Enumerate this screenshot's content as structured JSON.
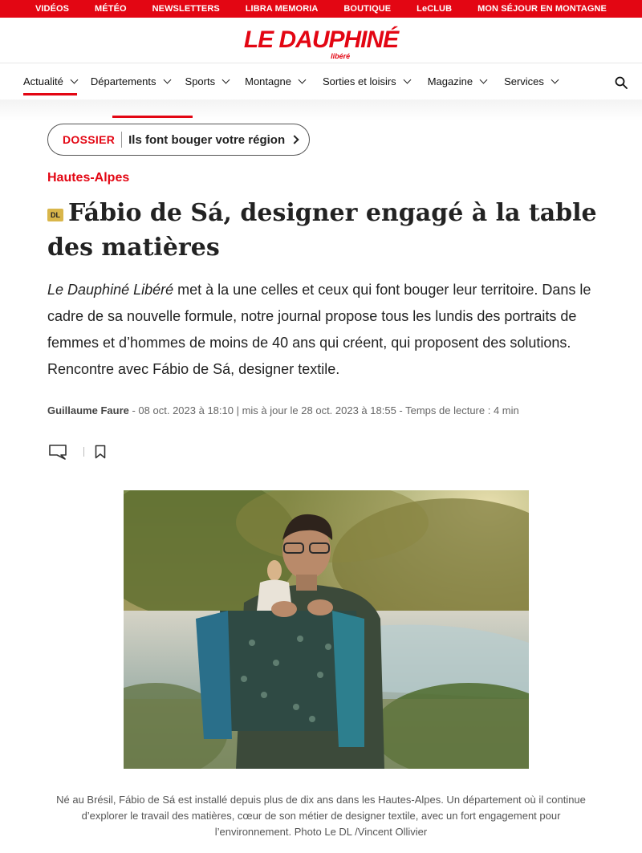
{
  "topbar": {
    "links": [
      "VIDÉOS",
      "MÉTÉO",
      "NEWSLETTERS",
      "LIBRA MEMORIA",
      "BOUTIQUE",
      "LeCLUB",
      "MON SÉJOUR EN MONTAGNE"
    ]
  },
  "logo": {
    "main": "LE DAUPHINÉ",
    "sub": "libéré"
  },
  "nav": {
    "items": [
      "Actualité",
      "Départements",
      "Sports",
      "Montagne",
      "Sorties et loisirs",
      "Magazine",
      "Services"
    ],
    "active_index": 0
  },
  "dossier": {
    "tag": "DOSSIER",
    "title": "Ils font bouger votre région"
  },
  "article": {
    "section": "Hautes-Alpes",
    "badge": "DL",
    "title": "Fábio de Sá, designer engagé à la table des matières",
    "lead_em": "Le Dauphiné Libéré",
    "lead_rest": " met à la une celles et ceux qui font bouger leur territoire. Dans le cadre de sa nouvelle formule, notre journal propose tous les lundis des portraits de femmes et d’hommes de moins de 40 ans qui créent, qui proposent des solutions. Rencontre avec Fábio de Sá, designer textile.",
    "author": "Guillaume Faure",
    "meta": " - 08 oct. 2023 à 18:10 | mis à jour le 28 oct. 2023 à 18:55 - Temps de lecture : 4 min",
    "caption": "Né au Brésil, Fábio de Sá est installé depuis plus de dix ans dans les Hautes-Alpes. Un département où il continue d’explorer le travail des matières, cœur de son métier de designer textile, avec un fort engagement pour l’environnement.  Photo Le DL /Vincent Ollivier"
  },
  "colors": {
    "brand_red": "#e30613",
    "badge_gold": "#d9b64a"
  },
  "icons": {
    "search": "search-icon",
    "comment": "comment-icon",
    "bookmark": "bookmark-icon"
  }
}
